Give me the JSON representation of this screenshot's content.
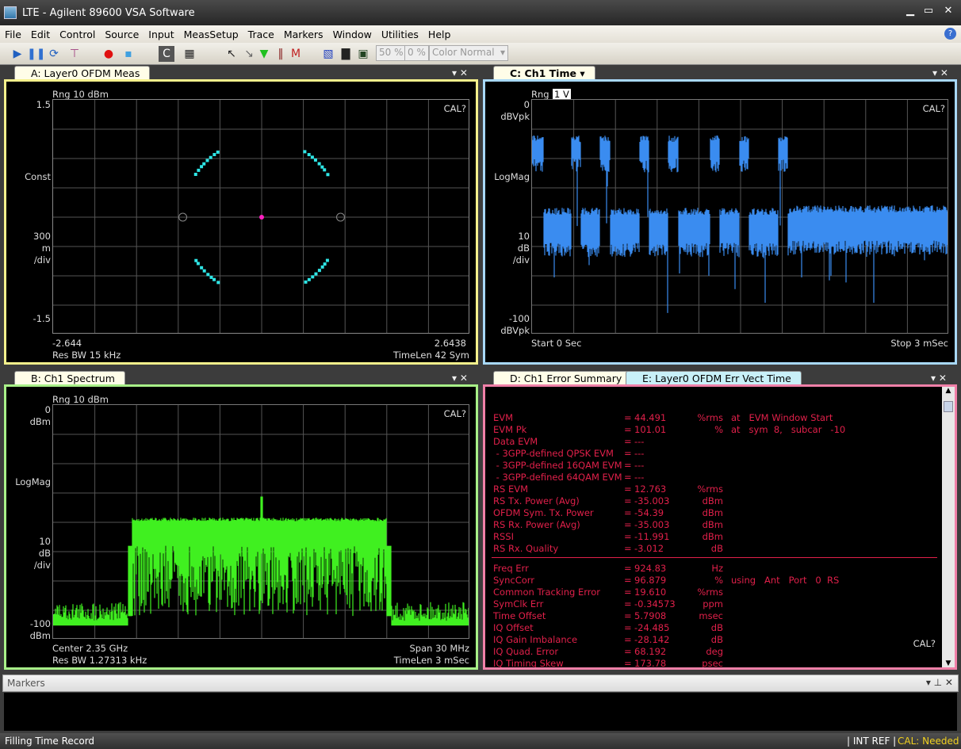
{
  "window": {
    "title": "LTE - Agilent 89600 VSA Software",
    "minimize": "▁",
    "maximize": "▭",
    "close": "✕"
  },
  "menu": [
    "File",
    "Edit",
    "Control",
    "Source",
    "Input",
    "MeasSetup",
    "Trace",
    "Markers",
    "Window",
    "Utilities",
    "Help"
  ],
  "toolbar": {
    "icons": [
      "play-icon",
      "pause-icon",
      "restart-icon",
      "single-icon",
      "record-icon",
      "playback-icon",
      "c-icon",
      "layout-icon",
      "pointer-icon",
      "zoom-pointer-icon",
      "marker-icon",
      "band-marker-icon",
      "peak-marker-icon",
      "spectrogram-icon",
      "spectrum-icon",
      "persistence-icon"
    ],
    "persist1": "50 %",
    "persist2": "0 %",
    "color_select": "Color Normal"
  },
  "panelA": {
    "tab": "A: Layer0 OFDM Meas",
    "color": "#f4f08c",
    "rng": "Rng 10 dBm",
    "cal": "CAL?",
    "y_top": "1.5",
    "y_name": "Const",
    "y_div": [
      "300",
      "m",
      "/div"
    ],
    "y_bot": "-1.5",
    "x_left": "-2.644",
    "x_right": "2.6438",
    "bl": "Res BW 15 kHz",
    "br": "TimeLen 42  Sym",
    "axes": {
      "x_range": [
        -2.644,
        2.6438
      ],
      "y_range": [
        -1.5,
        1.5
      ]
    },
    "point_color": "#2ee6e6",
    "center_color": "#ff20c0"
  },
  "panelC": {
    "tab": "C: Ch1 Time",
    "color": "#a8d8f8",
    "rng": "Rng",
    "rng_val": "1  V",
    "cal": "CAL?",
    "y_top": [
      "0",
      "dBVpk"
    ],
    "y_name": "LogMag",
    "y_div": [
      "10",
      "dB",
      "/div"
    ],
    "y_bot": [
      "-100",
      "dBVpk"
    ],
    "bl": "Start 0  Sec",
    "br": "Stop 3 mSec",
    "axes": {
      "x_range_ms": [
        0,
        3
      ],
      "y_range_dB": [
        -100,
        0
      ]
    },
    "trace_color": "#3a8cf0"
  },
  "panelB": {
    "tab": "B: Ch1 Spectrum",
    "color": "#a8f088",
    "rng": "Rng 10 dBm",
    "cal": "CAL?",
    "y_top": [
      "0",
      "dBm"
    ],
    "y_name": "LogMag",
    "y_div": [
      "10",
      "dB",
      "/div"
    ],
    "y_bot": [
      "-100",
      "dBm"
    ],
    "bl1": "Center 2.35 GHz",
    "bl2": "Res BW 1.27313 kHz",
    "br1": "Span 30 MHz",
    "br2": "TimeLen 3 mSec",
    "axes": {
      "center_GHz": 2.35,
      "span_MHz": 30,
      "y_range_dB": [
        -100,
        0
      ]
    },
    "trace_color": "#40f020"
  },
  "panelD": {
    "tab": "D: Ch1 Error Summary",
    "tab2": "E: Layer0 OFDM Err Vect Time",
    "color": "#f080a8",
    "cal": "CAL?",
    "rows1": [
      [
        "EVM",
        "=",
        "44.491",
        "%rms",
        "at   EVM Window Start"
      ],
      [
        "EVM Pk",
        "=",
        "101.01",
        "%",
        "at   sym  8,   subcar   -10"
      ],
      [
        "Data EVM",
        "=",
        "---",
        "",
        ""
      ],
      [
        " - 3GPP-defined QPSK EVM",
        "=",
        "---",
        "",
        ""
      ],
      [
        " - 3GPP-defined 16QAM EVM",
        "=",
        "---",
        "",
        ""
      ],
      [
        " - 3GPP-defined 64QAM EVM",
        "=",
        "---",
        "",
        ""
      ],
      [
        "RS EVM",
        "=",
        "12.763",
        "%rms",
        ""
      ],
      [
        "RS Tx. Power (Avg)",
        "=",
        "-35.003",
        "dBm",
        ""
      ],
      [
        "OFDM Sym. Tx. Power",
        "=",
        "-54.39",
        "dBm",
        ""
      ],
      [
        "RS Rx. Power (Avg)",
        "=",
        "-35.003",
        "dBm",
        ""
      ],
      [
        "RSSI",
        "=",
        "-11.991",
        "dBm",
        ""
      ],
      [
        "RS Rx. Quality",
        "=",
        "-3.012",
        "dB",
        ""
      ]
    ],
    "rows2": [
      [
        "Freq Err",
        "=",
        "924.83",
        "Hz",
        ""
      ],
      [
        "SyncCorr",
        "=",
        "96.879",
        "%",
        "using   Ant   Port   0  RS"
      ],
      [
        "Common Tracking Error",
        "=",
        "19.610",
        "%rms",
        ""
      ],
      [
        "SymClk Err",
        "=",
        "-0.34573",
        "ppm",
        ""
      ],
      [
        "Time Offset",
        "=",
        "5.7908",
        "msec",
        ""
      ],
      [
        "IQ Offset",
        "=",
        "-24.485",
        "dB",
        ""
      ],
      [
        "IQ Gain Imbalance",
        "=",
        "-28.142",
        "dB",
        ""
      ],
      [
        "IQ Quad. Error",
        "=",
        "68.192",
        "deg",
        ""
      ],
      [
        "IQ Timing Skew",
        "=",
        "173.78",
        "psec",
        ""
      ]
    ]
  },
  "markers": {
    "title": "Markers"
  },
  "status": {
    "left": "Filling Time Record",
    "ref": "INT REF",
    "cal": "CAL: Needed",
    "cal_color": "#f0d020"
  }
}
